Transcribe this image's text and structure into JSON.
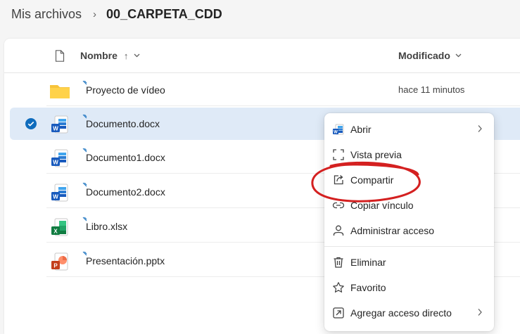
{
  "breadcrumb": {
    "root": "Mis archivos",
    "separator": "›",
    "current": "00_CARPETA_CDD"
  },
  "header": {
    "name": "Nombre",
    "sort_arrow": "↑",
    "modified": "Modificado",
    "chevron": "⌄"
  },
  "rows": [
    {
      "name": "Proyecto de vídeo",
      "modified": "hace 11 minutos",
      "type": "folder-icon"
    },
    {
      "name": "Documento.docx",
      "modified": "",
      "type": "word-icon",
      "selected": true
    },
    {
      "name": "Documento1.docx",
      "modified": "",
      "type": "word-icon"
    },
    {
      "name": "Documento2.docx",
      "modified": "",
      "type": "word-icon"
    },
    {
      "name": "Libro.xlsx",
      "modified": "",
      "type": "excel-icon"
    },
    {
      "name": "Presentación.pptx",
      "modified": "",
      "type": "powerpoint-icon"
    }
  ],
  "context_menu": {
    "items": [
      {
        "label": "Abrir",
        "icon": "word-icon",
        "submenu": true
      },
      {
        "label": "Vista previa",
        "icon": "preview-icon"
      },
      {
        "label": "Compartir",
        "icon": "share-icon",
        "highlighted": true
      },
      {
        "label": "Copiar vínculo",
        "icon": "link-icon"
      },
      {
        "label": "Administrar acceso",
        "icon": "person-icon"
      },
      {
        "label": "Eliminar",
        "icon": "trash-icon"
      },
      {
        "label": "Favorito",
        "icon": "star-icon"
      },
      {
        "label": "Agregar acceso directo",
        "icon": "shortcut-icon",
        "submenu": true
      }
    ]
  },
  "colors": {
    "accent": "#0f6cbd",
    "selected_row": "#dfeaf7",
    "annotation": "#d42020",
    "folder": "#f7c33a"
  }
}
